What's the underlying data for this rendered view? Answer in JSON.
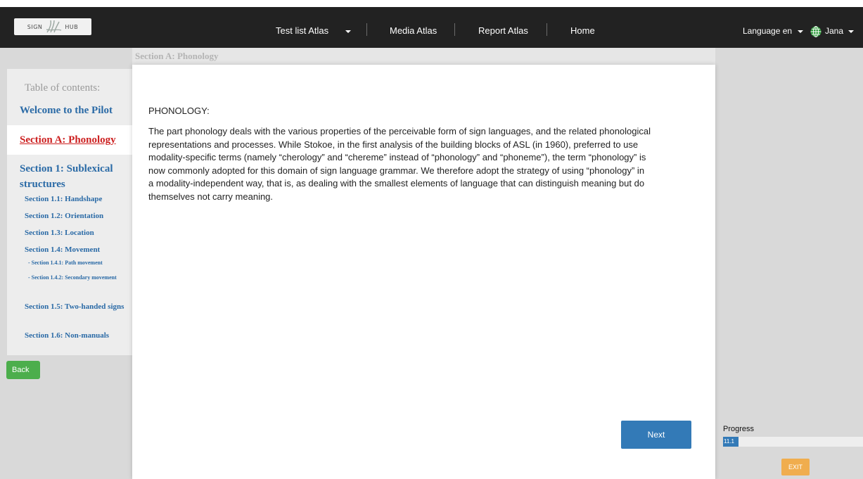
{
  "navbar": {
    "logo_left": "SIGN",
    "logo_right": "HUB",
    "test_list_label": "Test list Atlas",
    "media_atlas_label": "Media Atlas",
    "report_atlas_label": "Report Atlas",
    "home_label": "Home",
    "language_label": "Language en",
    "user_label": "Jana"
  },
  "section": {
    "title": "Section A: Phonology"
  },
  "toc": {
    "title": "Table of contents:",
    "items": [
      {
        "label": "Welcome to the Pilot",
        "level": 1
      },
      {
        "label": "Section A: Phonology",
        "level": 1,
        "active": true
      },
      {
        "label": "Section 1: Sublexical structures",
        "level": 1
      },
      {
        "label": "Section 1.1: Handshape",
        "level": 2
      },
      {
        "label": "Section 1.2: Orientation",
        "level": 2
      },
      {
        "label": "Section 1.3: Location",
        "level": 2
      },
      {
        "label": "Section 1.4: Movement",
        "level": 2
      },
      {
        "label": "- Section 1.4.1: Path movement",
        "level": 3
      },
      {
        "label": "- Section 1.4.2: Secondary movement",
        "level": 3
      },
      {
        "label": "Section 1.5: Two-handed signs",
        "level": 2
      },
      {
        "label": "Section 1.6: Non-manuals",
        "level": 2
      }
    ]
  },
  "content": {
    "heading": "PHONOLOGY:",
    "body": "The part phonology deals with the various properties of the perceivable form of sign languages, and the related phonological representations and processes. While Stokoe, in the first analysis of the building blocks of ASL (in 1960), preferred to use modality-specific terms (namely “cherology” and “chereme” instead of “phonology” and “phoneme”), the term “phonology” is now commonly adopted for this domain of sign language grammar. We therefore adopt the strategy of using “phonology” in a modality-independent way, that is, as dealing with the smallest elements of language that can distinguish meaning but do themselves not carry meaning."
  },
  "buttons": {
    "back": "Back",
    "next": "Next",
    "exit": "EXIT"
  },
  "progress": {
    "label": "Progress",
    "text": "11.1",
    "fraction": 0.111
  },
  "colors": {
    "navbar": "#222222",
    "link": "#2a6aa6",
    "active_link": "#cc1f1f",
    "primary": "#337ab7",
    "success": "#4cae4c",
    "warning": "#f0ad4e"
  }
}
